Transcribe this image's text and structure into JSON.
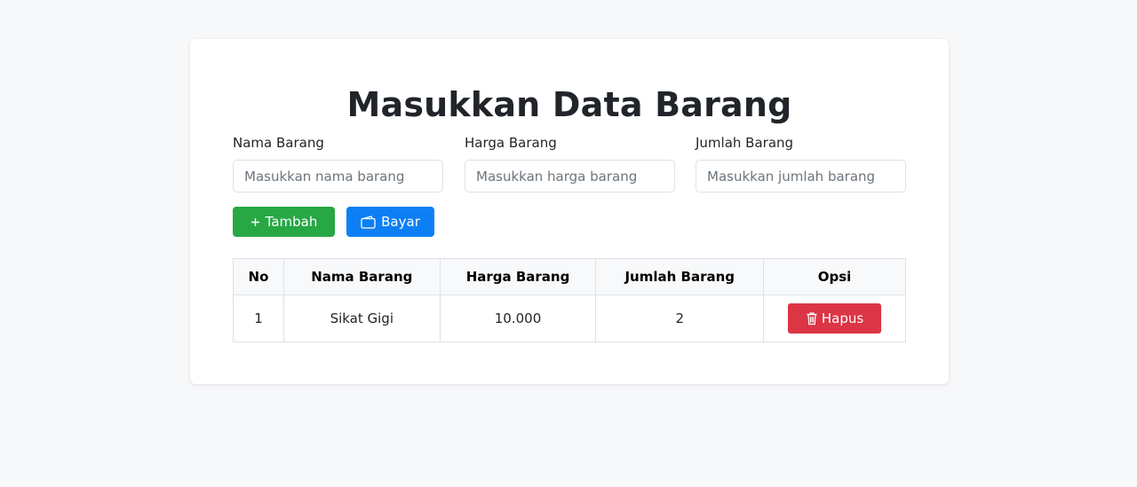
{
  "page": {
    "title": "Masukkan Data Barang"
  },
  "form": {
    "fields": [
      {
        "label": "Nama Barang",
        "placeholder": "Masukkan nama barang",
        "value": ""
      },
      {
        "label": "Harga Barang",
        "placeholder": "Masukkan harga barang",
        "value": ""
      },
      {
        "label": "Jumlah Barang",
        "placeholder": "Masukkan jumlah barang",
        "value": ""
      }
    ],
    "add_button": {
      "label": "Tambah",
      "icon": "plus-icon",
      "color": "#28a745"
    },
    "pay_button": {
      "label": "Bayar",
      "icon": "wallet-icon",
      "color": "#0d7ff5"
    }
  },
  "table": {
    "headers": [
      "No",
      "Nama Barang",
      "Harga Barang",
      "Jumlah Barang",
      "Opsi"
    ],
    "rows": [
      {
        "no": "1",
        "nama": "Sikat Gigi",
        "harga": "10.000",
        "jumlah": "2",
        "action_label": "Hapus",
        "action_icon": "trash-icon"
      }
    ],
    "delete_color": "#dc3545"
  }
}
